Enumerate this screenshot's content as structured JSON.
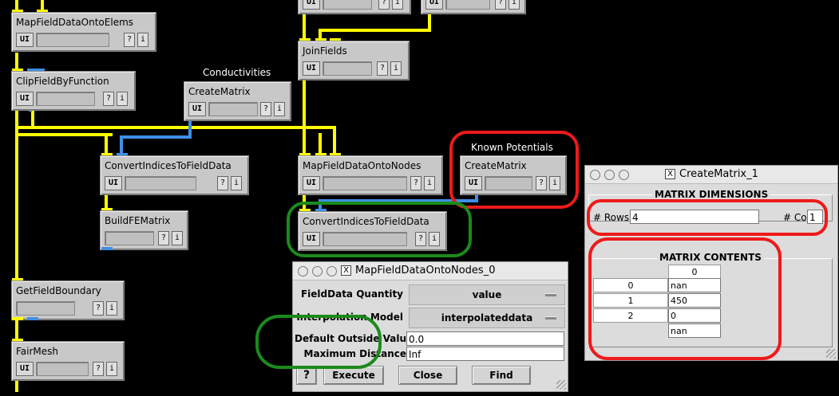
{
  "modules": {
    "map_field_data_onto_elems": {
      "title": "MapFieldDataOntoElems",
      "ui": "UI",
      "help": "?",
      "info": "i"
    },
    "clip_field_by_function": {
      "title": "ClipFieldByFunction",
      "ui": "UI",
      "help": "?",
      "info": "i"
    },
    "create_matrix_conductivities": {
      "title": "CreateMatrix",
      "caption": "Conductivities",
      "ui": "UI",
      "help": "?",
      "info": "i"
    },
    "join_fields": {
      "title": "JoinFields",
      "ui": "UI",
      "help": "?",
      "info": "i"
    },
    "convert_indices_left": {
      "title": "ConvertIndicesToFieldData",
      "ui": "UI",
      "help": "?",
      "info": "i"
    },
    "build_fe_matrix": {
      "title": "BuildFEMatrix",
      "help": "?",
      "info": "i"
    },
    "map_field_data_onto_nodes": {
      "title": "MapFieldDataOntoNodes",
      "ui": "UI",
      "help": "?",
      "info": "i"
    },
    "create_matrix_known": {
      "title": "CreateMatrix",
      "caption": "Known Potentials",
      "ui": "UI",
      "help": "?",
      "info": "i"
    },
    "convert_indices_mid": {
      "title": "ConvertIndicesToFieldData",
      "ui": "UI",
      "help": "?",
      "info": "i"
    },
    "get_field_boundary": {
      "title": "GetFieldBoundary",
      "help": "?",
      "info": "i"
    },
    "fair_mesh": {
      "title": "FairMesh",
      "ui": "UI",
      "help": "?",
      "info": "i"
    },
    "top_partial_1": {
      "ui": "UI",
      "help": "?",
      "info": "i"
    },
    "top_partial_2": {
      "ui": "UI",
      "help": "?",
      "info": "i"
    }
  },
  "map_window": {
    "title": "MapFieldDataOntoNodes_0",
    "close_glyph": "X",
    "fields": [
      {
        "label": "FieldData Quantity",
        "value": "value"
      },
      {
        "label": "Interpolation Model",
        "value": "interpolateddata"
      },
      {
        "label": "Default Outside Value",
        "value": "0.0"
      },
      {
        "label": "Maximum Distance",
        "value": "Inf"
      }
    ],
    "help_label": "?",
    "execute_label": "Execute",
    "close_label": "Close",
    "find_label": "Find"
  },
  "matrix_window": {
    "title": "CreateMatrix_1",
    "close_glyph": "X",
    "dimensions_label": "MATRIX DIMENSIONS",
    "rows_label": "# Rows",
    "rows_value": "4",
    "cols_label": "# Cols",
    "cols_value": "1",
    "contents_label": "MATRIX CONTENTS",
    "col_header": "0",
    "rows": [
      {
        "index": "0",
        "value": "nan"
      },
      {
        "index": "1",
        "value": "450"
      },
      {
        "index": "2",
        "value": "0"
      },
      {
        "index": "",
        "value": "nan"
      }
    ]
  },
  "colors": {
    "canvas": "#000000",
    "wire_yellow": "#ffff00",
    "wire_blue": "#3f8fe6",
    "highlight_red": "#ee1a1a",
    "highlight_green": "#1b8a1b"
  }
}
